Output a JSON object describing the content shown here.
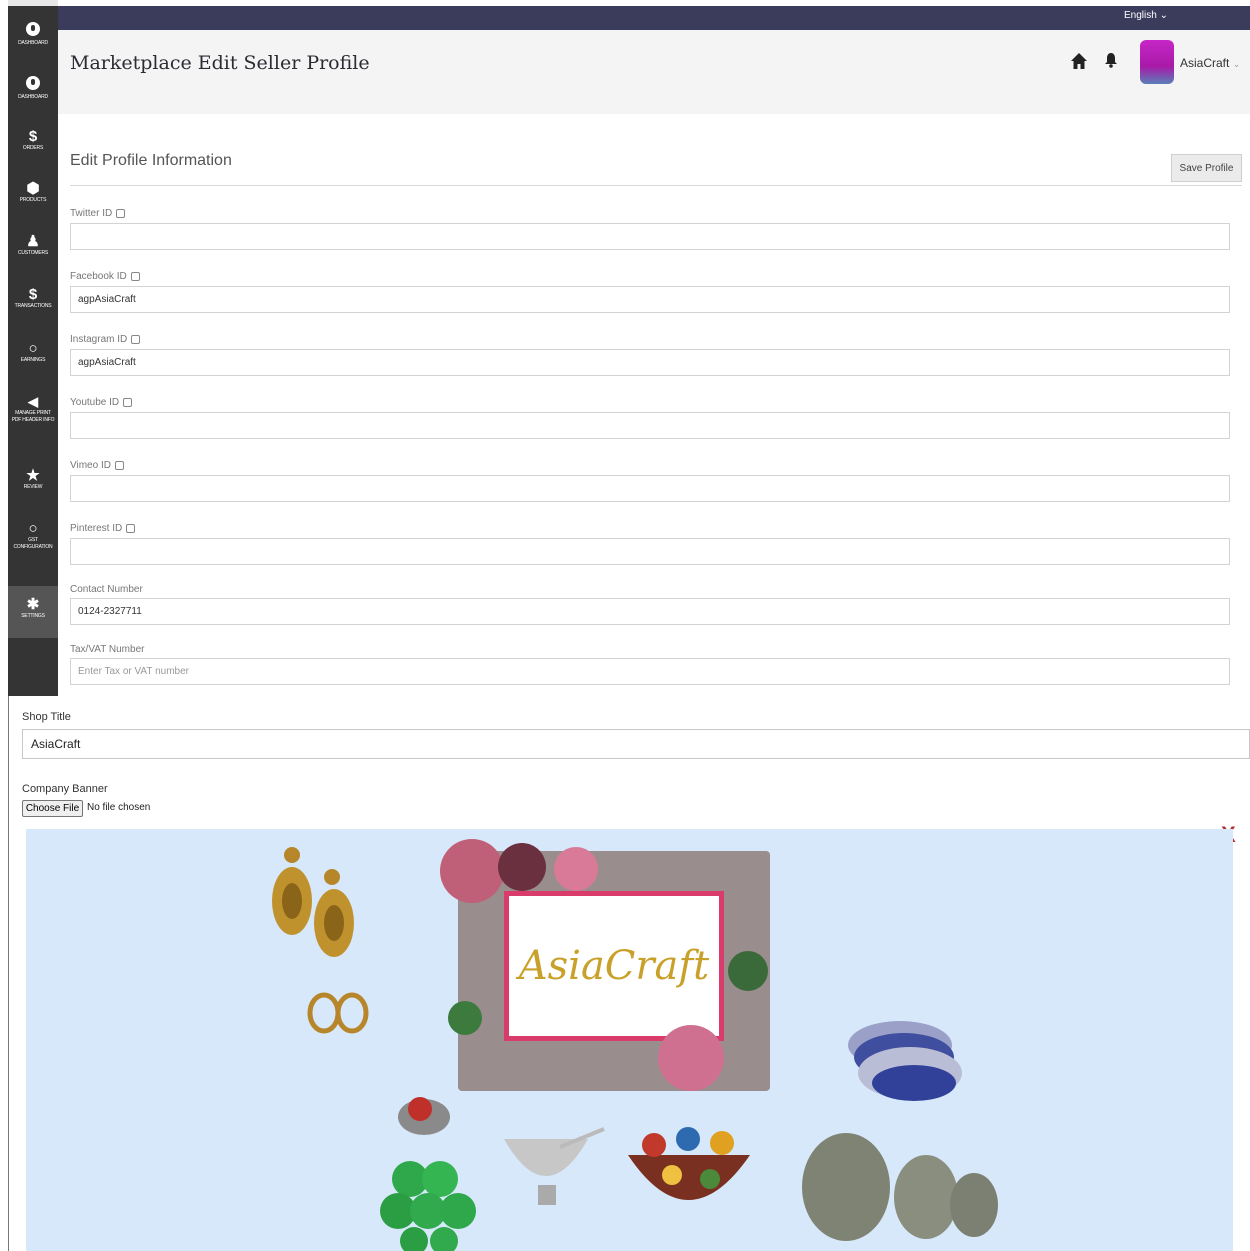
{
  "topbar": {
    "language": "English"
  },
  "sidebar": {
    "items": [
      {
        "label": "DASHBOARD",
        "icon": "dashboard-icon",
        "glyph": "◔"
      },
      {
        "label": "DASHBOARD",
        "icon": "dashboard-icon",
        "glyph": "◔"
      },
      {
        "label": "ORDERS",
        "icon": "dollar-icon",
        "glyph": "$"
      },
      {
        "label": "PRODUCTS",
        "icon": "cube-icon",
        "glyph": "⬢"
      },
      {
        "label": "CUSTOMERS",
        "icon": "person-icon",
        "glyph": "♟"
      },
      {
        "label": "TRANSACTIONS",
        "icon": "dollar-icon",
        "glyph": "$"
      },
      {
        "label": "EARNINGS",
        "icon": "circle-icon",
        "glyph": "○"
      },
      {
        "label": "MANAGE PRINT PDF HEADER INFO",
        "icon": "megaphone-icon",
        "glyph": "📢"
      },
      {
        "label": "REVIEW",
        "icon": "star-icon",
        "glyph": "★"
      },
      {
        "label": "GST CONFIGURATION",
        "icon": "circle-icon",
        "glyph": "○"
      },
      {
        "label": "SETTINGS",
        "icon": "gear-icon",
        "glyph": "✱"
      }
    ]
  },
  "header": {
    "title": "Marketplace Edit Seller Profile",
    "user_name": "AsiaCraft"
  },
  "form": {
    "section_title": "Edit Profile Information",
    "save_label": "Save Profile",
    "fields": [
      {
        "label": "Twitter ID",
        "value": "",
        "checkbox": true
      },
      {
        "label": "Facebook ID",
        "value": "agpAsiaCraft",
        "checkbox": true
      },
      {
        "label": "Instagram ID",
        "value": "agpAsiaCraft",
        "checkbox": true
      },
      {
        "label": "Youtube ID",
        "value": "",
        "checkbox": true
      },
      {
        "label": "Vimeo ID",
        "value": "",
        "checkbox": true
      },
      {
        "label": "Pinterest ID",
        "value": "",
        "checkbox": true
      },
      {
        "label": "Contact Number",
        "value": "0124-2327711",
        "checkbox": false
      },
      {
        "label": "Tax/VAT Number",
        "value": "",
        "placeholder": "Enter Tax or VAT number",
        "checkbox": false
      }
    ]
  },
  "shop": {
    "label": "Shop Title",
    "value": "AsiaCraft"
  },
  "banner": {
    "label": "Company Banner",
    "choose_label": "Choose File",
    "file_status": "No file chosen",
    "close_glyph": "X",
    "logo_text": "AsiaCraft"
  }
}
